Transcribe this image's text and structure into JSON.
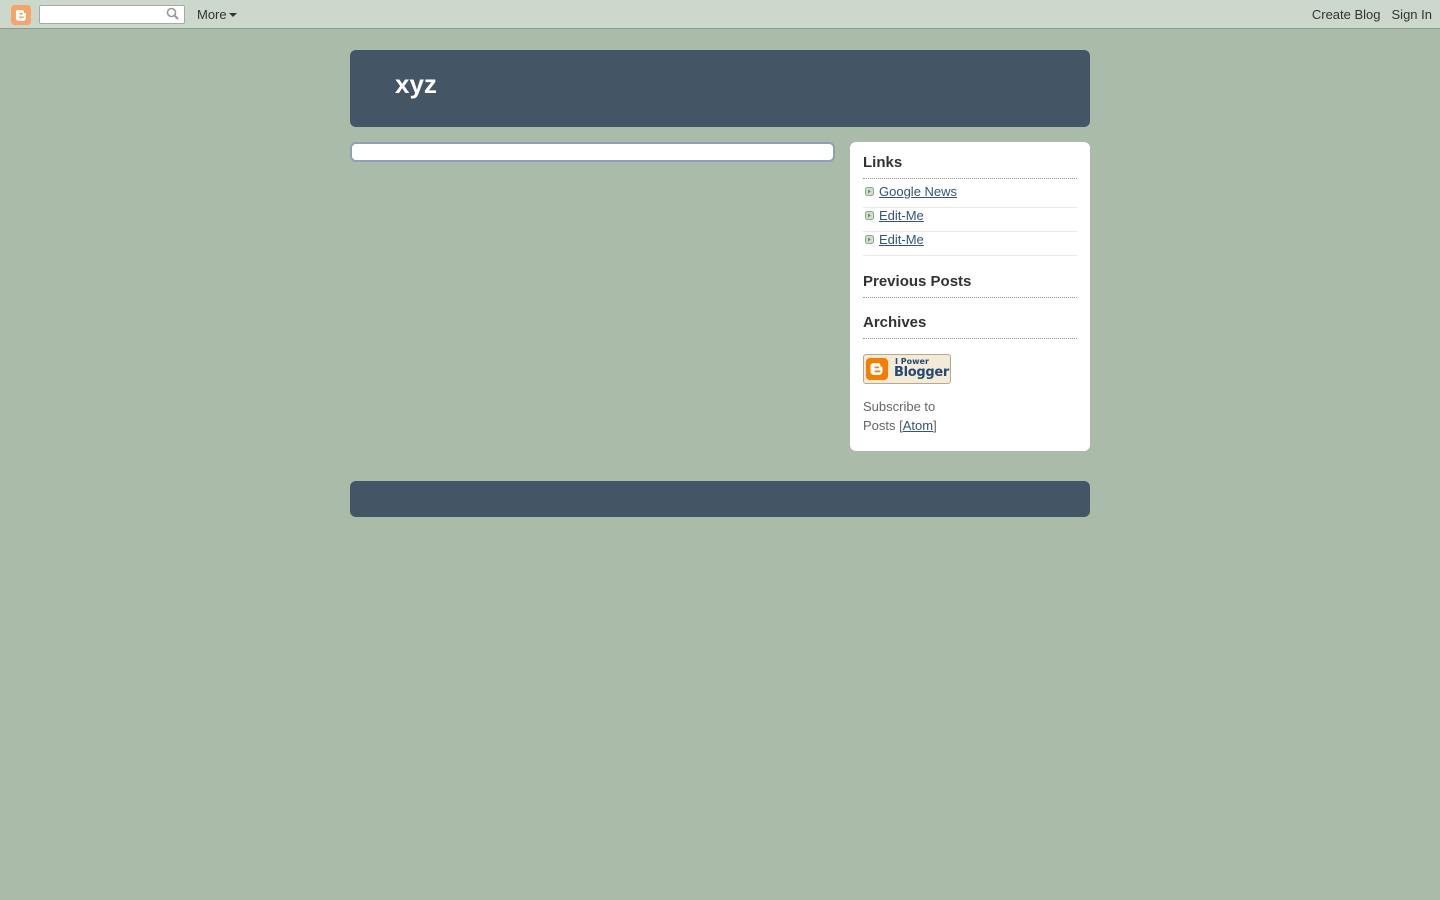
{
  "navbar": {
    "search_value": "",
    "more_label": "More",
    "create_blog_label": "Create Blog",
    "sign_in_label": "Sign In"
  },
  "header": {
    "title": "xyz"
  },
  "sidebar": {
    "links_heading": "Links",
    "links": [
      {
        "label": "Google News"
      },
      {
        "label": "Edit-Me"
      },
      {
        "label": "Edit-Me"
      }
    ],
    "previous_posts_heading": "Previous Posts",
    "archives_heading": "Archives",
    "badge": {
      "small_text": "I Power",
      "big_text": "Blogger"
    },
    "subscribe": {
      "prefix": "Subscribe to Posts [",
      "link_label": "Atom",
      "suffix": "]"
    }
  },
  "colors": {
    "background": "#aabbaa",
    "header_footer": "#445566",
    "link": "#335577",
    "blogger_orange": "#f57d00"
  }
}
